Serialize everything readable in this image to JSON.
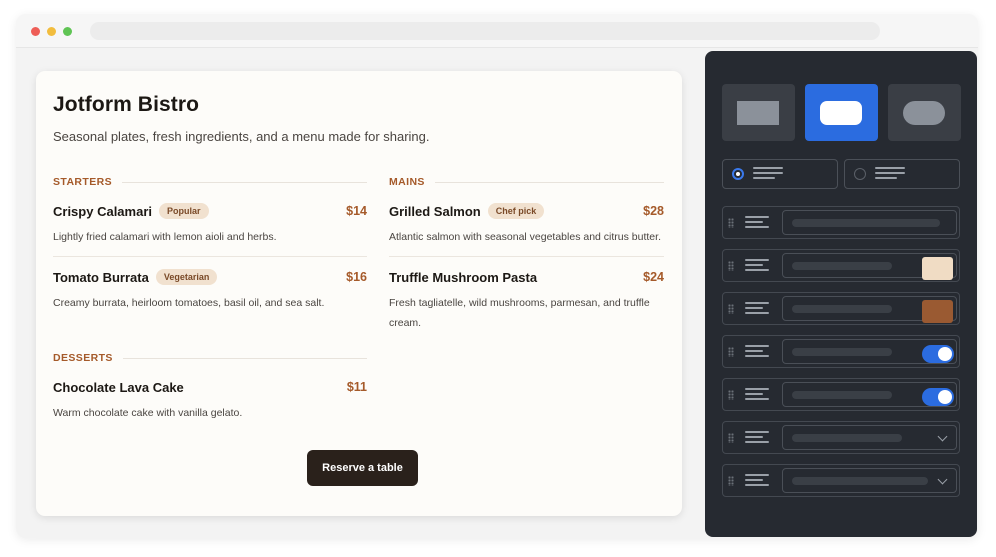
{
  "menu": {
    "title": "Jotform Bistro",
    "subtitle": "Seasonal plates, fresh ingredients, and a menu made for sharing.",
    "sections": {
      "starters": {
        "label": "STARTERS",
        "items": [
          {
            "name": "Crispy Calamari",
            "badge": "Popular",
            "price": "$14",
            "description": "Lightly fried calamari with lemon aioli and herbs."
          },
          {
            "name": "Tomato Burrata",
            "badge": "Vegetarian",
            "price": "$16",
            "description": "Creamy burrata, heirloom tomatoes, basil oil, and sea salt."
          }
        ]
      },
      "mains": {
        "label": "MAINS",
        "items": [
          {
            "name": "Grilled Salmon",
            "badge": "Chef pick",
            "price": "$28",
            "description": "Atlantic salmon with seasonal vegetables and citrus butter."
          },
          {
            "name": "Truffle Mushroom Pasta",
            "price": "$24",
            "description_line1": "Fresh tagliatelle, wild mushrooms, parmesan, and truffle",
            "description_line2": "cream."
          }
        ]
      },
      "desserts": {
        "label": "DESSERTS",
        "items": [
          {
            "name": "Chocolate Lava Cake",
            "price": "$11",
            "description": "Warm chocolate cake with vanilla gelato."
          }
        ]
      }
    },
    "reserve_label": "Reserve a table"
  },
  "colors": {
    "accent": "#a55a2a",
    "panel_bg": "#262a31",
    "active_blue": "#2b6ce0",
    "swatch_cream": "#f0dcc4",
    "swatch_brown": "#9a5a32"
  },
  "panel": {
    "layout_options": [
      "rectangle-shape",
      "rounded-shape",
      "pill-shape"
    ],
    "selected_layout": "rounded-shape",
    "rows": [
      "text-field",
      "color-field",
      "color-field",
      "toggle-field",
      "toggle-field",
      "dropdown-field",
      "dropdown-field"
    ]
  }
}
